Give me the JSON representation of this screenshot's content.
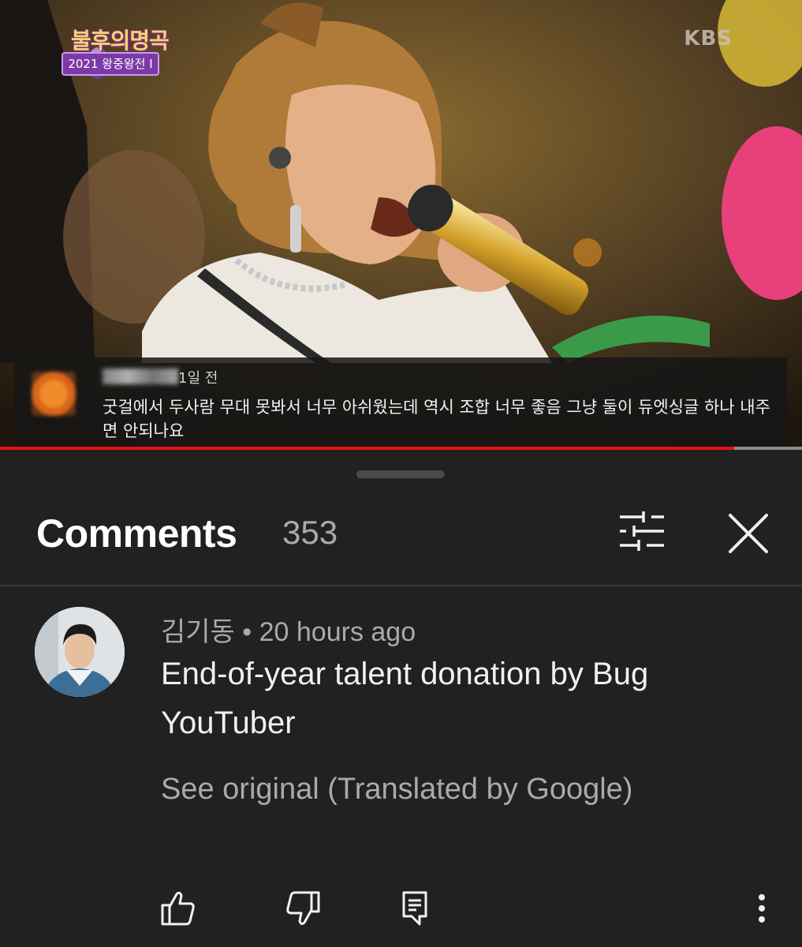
{
  "video": {
    "show_title": "불후의명곡",
    "show_subtitle": "2021 왕중왕전 I",
    "broadcaster": "KBS",
    "progress_fraction": 0.915,
    "overlay_comment": {
      "time": "1일 전",
      "text": "굿걸에서 두사람 무대 못봐서 너무 아쉬웠는데 역시 조합 너무 좋음 그냥 둘이 듀엣싱글 하나 내주면 안되나요"
    }
  },
  "comments_panel": {
    "title": "Comments",
    "count": "353",
    "filter_icon": "sliders-icon",
    "close_icon": "close-icon"
  },
  "comment": {
    "meta": "김기동 • 20 hours ago",
    "text": "End-of-year talent donation by Bug YouTuber",
    "see_original": "See original (Translated by Google)",
    "actions": {
      "like_icon": "thumbs-up-icon",
      "dislike_icon": "thumbs-down-icon",
      "reply_icon": "reply-icon",
      "more_icon": "more-vertical-icon"
    }
  },
  "colors": {
    "background": "#212121",
    "progress": "#e4120f",
    "text_primary": "#f1f1f1",
    "text_secondary": "#aaaaaa"
  }
}
